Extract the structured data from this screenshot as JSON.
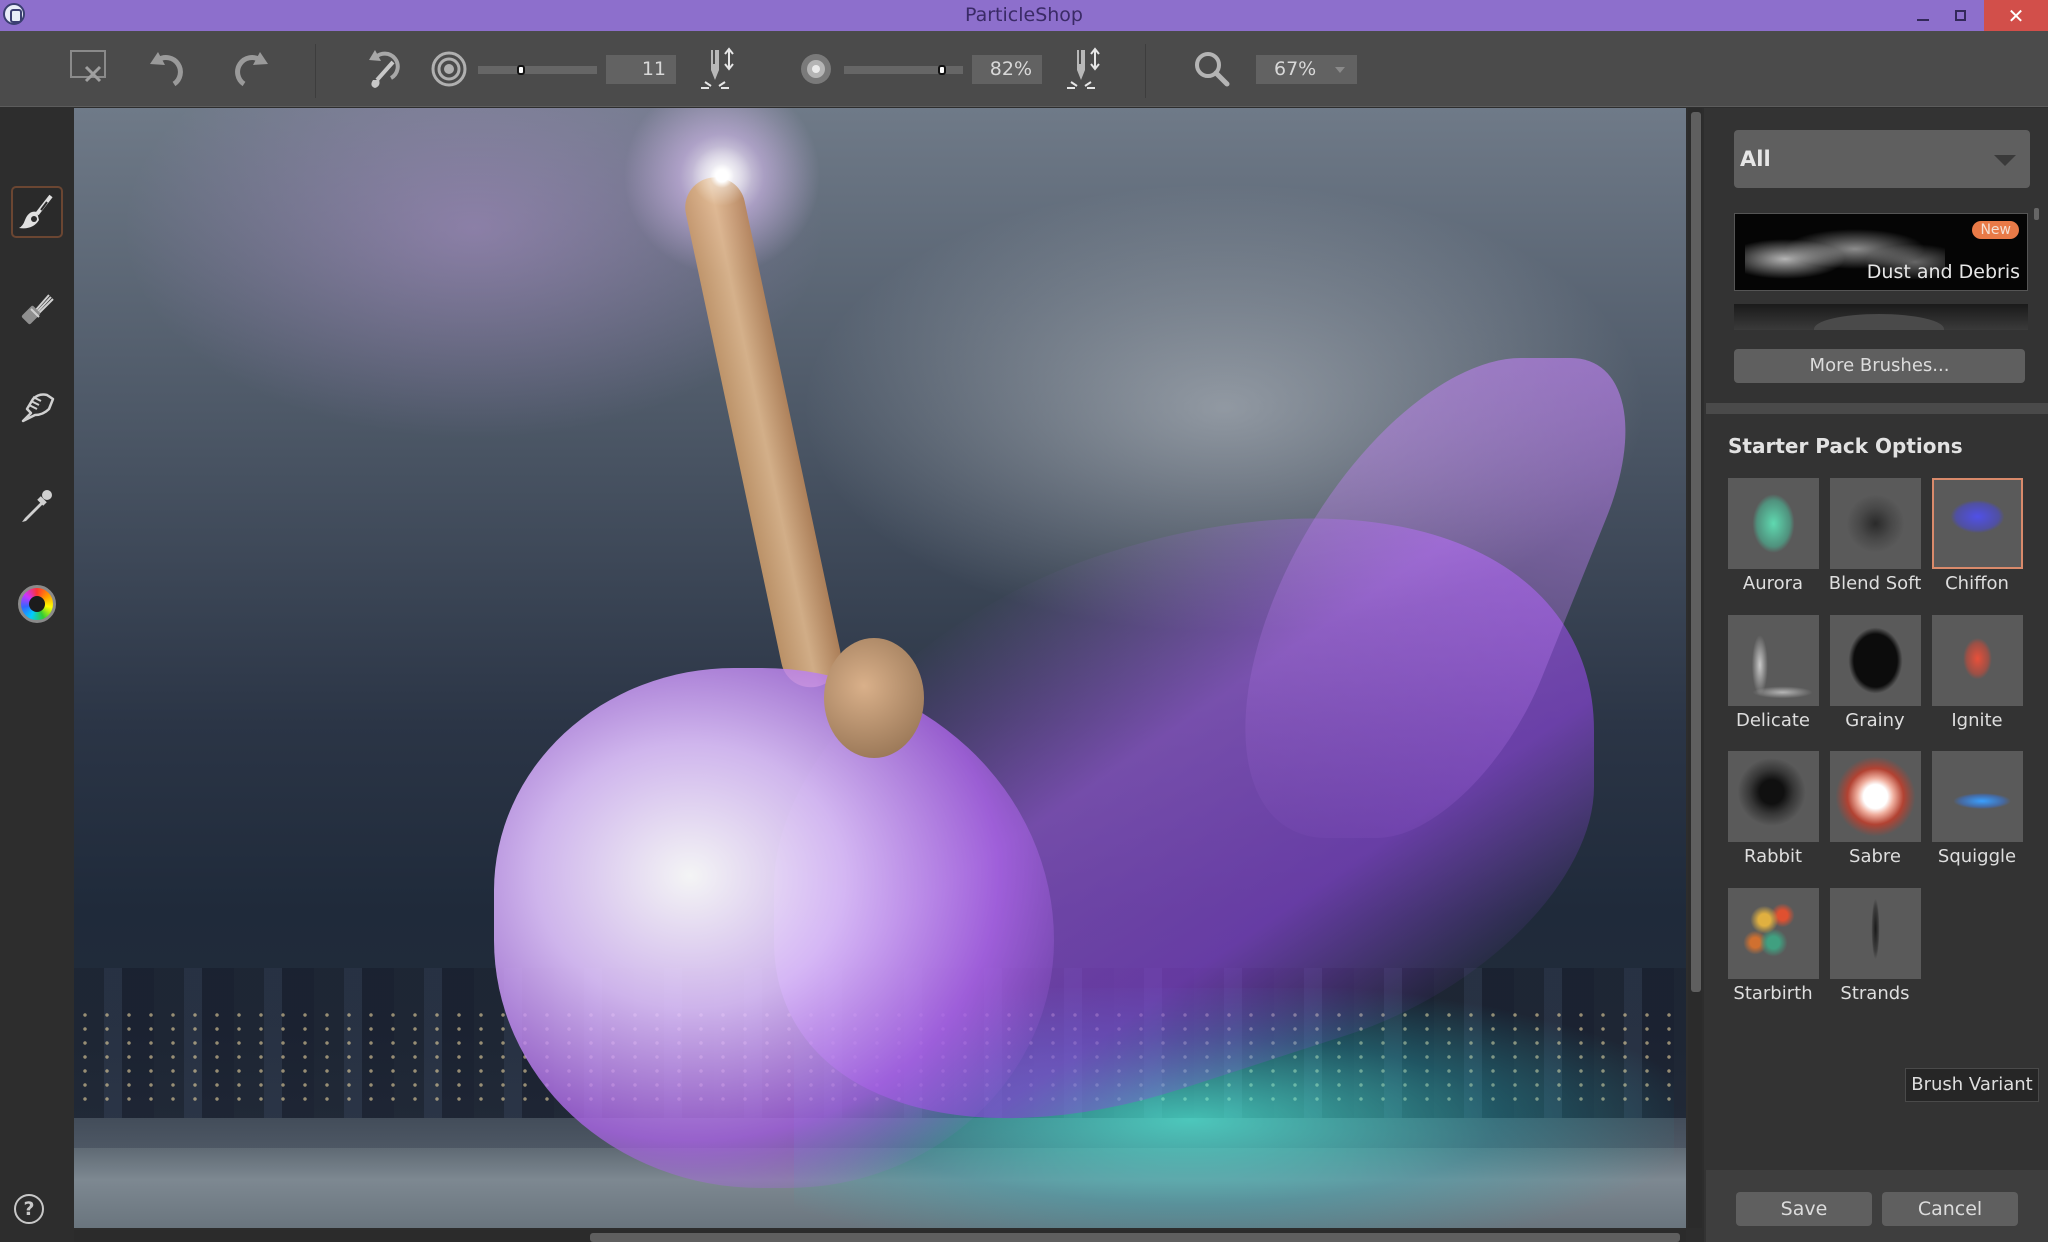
{
  "window": {
    "title": "ParticleShop",
    "controls": {
      "minimize": "minimize",
      "maximize": "restore",
      "close": "✕"
    }
  },
  "toolbar": {
    "clear_icon": "clear-canvas-icon",
    "undo_icon": "undo-icon",
    "redo_icon": "redo-icon",
    "brush_reset_icon": "reset-brush-icon",
    "size": {
      "icon": "brush-size-icon",
      "value": "11",
      "slider_fraction": 0.36
    },
    "size_pressure_icon": "pen-pressure-size-icon",
    "opacity": {
      "icon": "opacity-icon",
      "value": "82%",
      "slider_fraction": 0.82
    },
    "opacity_pressure_icon": "pen-pressure-opacity-icon",
    "zoom": {
      "icon": "zoom-icon",
      "value": "67%"
    }
  },
  "tools": [
    {
      "name": "brush",
      "active": true
    },
    {
      "name": "smudge",
      "active": false
    },
    {
      "name": "grab",
      "active": false
    },
    {
      "name": "eyedropper",
      "active": false
    },
    {
      "name": "color-wheel",
      "active": false
    }
  ],
  "help": {
    "label": "?"
  },
  "right_panel": {
    "category": {
      "value": "All"
    },
    "brush_packs": [
      {
        "name": "Dust and Debris",
        "badge": "New"
      }
    ],
    "more_brushes_label": "More Brushes...",
    "section_title": "Starter Pack Options",
    "brushes": [
      {
        "name": "Aurora",
        "selected": false
      },
      {
        "name": "Blend Soft",
        "selected": false
      },
      {
        "name": "Chiffon",
        "selected": true
      },
      {
        "name": "Delicate",
        "selected": false
      },
      {
        "name": "Grainy",
        "selected": false
      },
      {
        "name": "Ignite",
        "selected": false
      },
      {
        "name": "Rabbit",
        "selected": false
      },
      {
        "name": "Sabre",
        "selected": false
      },
      {
        "name": "Squiggle",
        "selected": false
      },
      {
        "name": "Starbirth",
        "selected": false
      },
      {
        "name": "Strands",
        "selected": false
      }
    ],
    "brush_variant_label": "Brush Variant",
    "save_label": "Save",
    "cancel_label": "Cancel"
  },
  "colors": {
    "titlebar": "#8d6fcc",
    "close_button": "#d24f4a",
    "badge": "#e97a47",
    "selected_outline": "#d98a6b"
  }
}
